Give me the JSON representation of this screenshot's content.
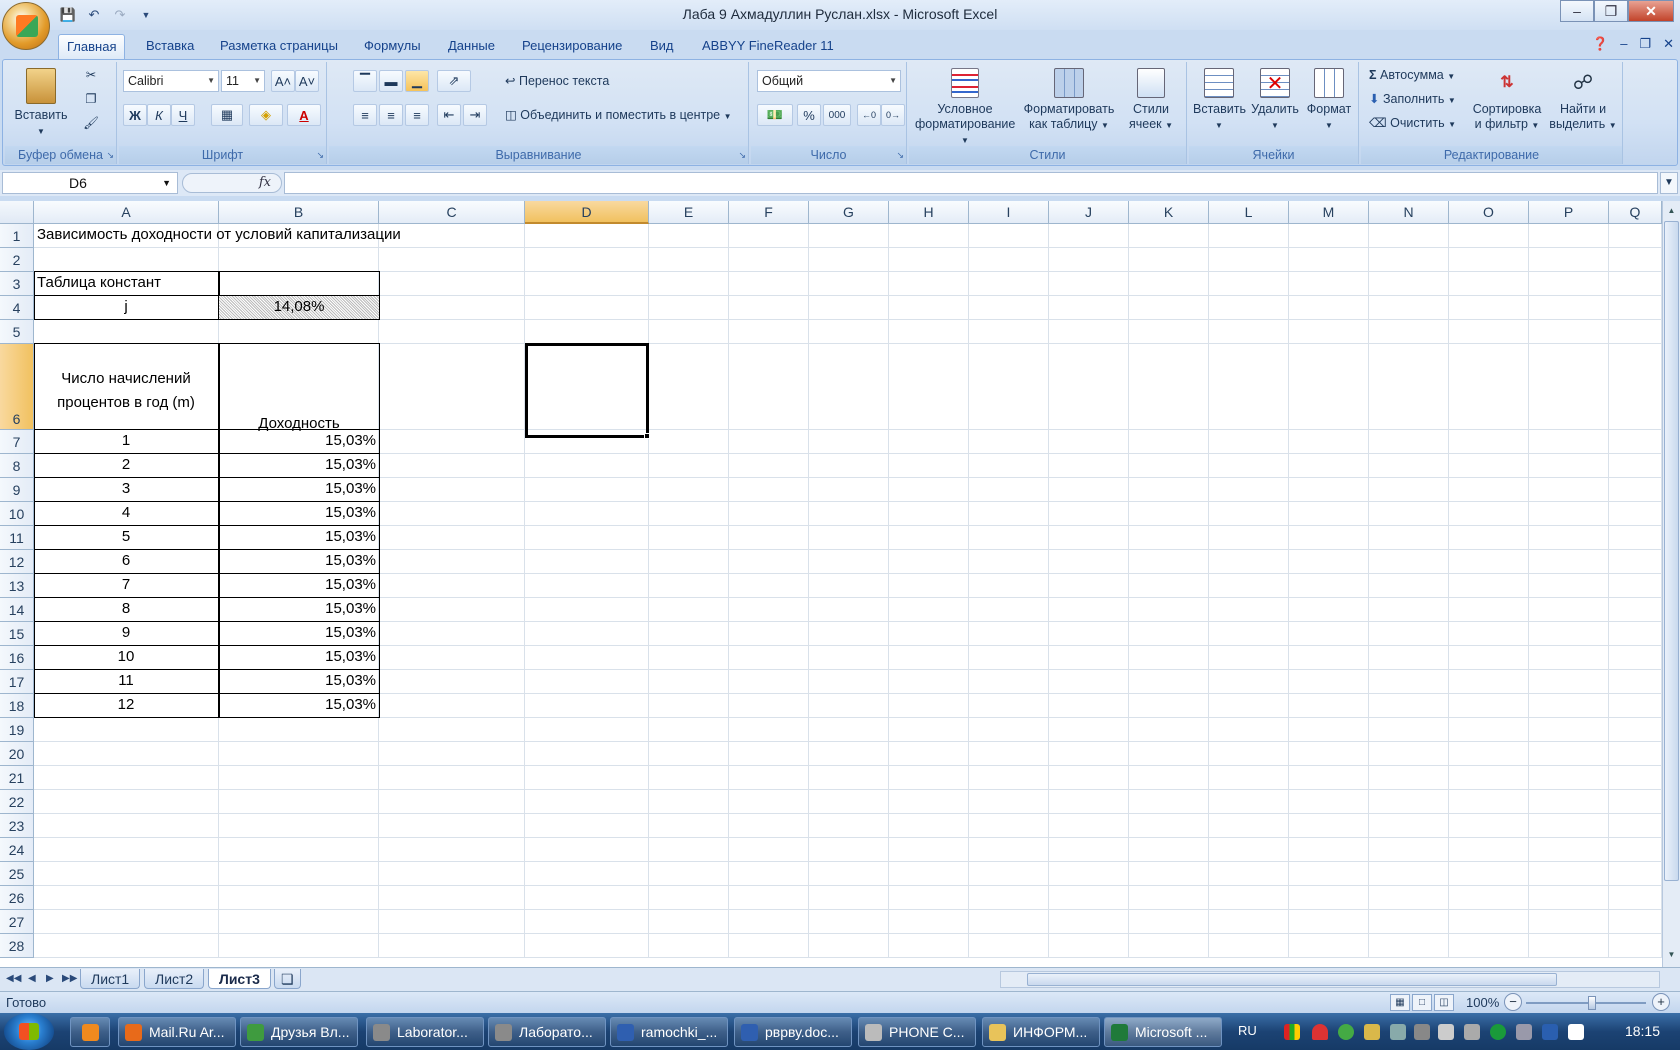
{
  "window": {
    "title": "Лаба 9 Ахмадуллин  Руслан.xlsx - Microsoft Excel",
    "controls": [
      "–",
      "❐",
      "✕"
    ]
  },
  "ribbon_tabs": [
    {
      "label": "Главная",
      "active": true
    },
    {
      "label": "Вставка"
    },
    {
      "label": "Разметка страницы"
    },
    {
      "label": "Формулы"
    },
    {
      "label": "Данные"
    },
    {
      "label": "Рецензирование"
    },
    {
      "label": "Вид"
    },
    {
      "label": "ABBYY FineReader 11"
    }
  ],
  "ribbon": {
    "clipboard": {
      "label": "Буфер обмена",
      "paste": "Вставить"
    },
    "font": {
      "label": "Шрифт",
      "name": "Calibri",
      "size": "11",
      "bold": "Ж",
      "italic": "К",
      "underline": "Ч"
    },
    "alignment": {
      "label": "Выравнивание",
      "wrap": "Перенос текста",
      "merge": "Объединить и поместить в центре"
    },
    "number": {
      "label": "Число",
      "format": "Общий",
      "percent": "%",
      "thousands": "000"
    },
    "styles": {
      "label": "Стили",
      "cond_1": "Условное",
      "cond_2": "форматирование",
      "table_1": "Форматировать",
      "table_2": "как таблицу",
      "cell_1": "Стили",
      "cell_2": "ячеек"
    },
    "cells": {
      "label": "Ячейки",
      "insert": "Вставить",
      "delete": "Удалить",
      "format": "Формат"
    },
    "editing": {
      "label": "Редактирование",
      "autosum": "Автосумма",
      "fill": "Заполнить",
      "clear": "Очистить",
      "sort_1": "Сортировка",
      "sort_2": "и фильтр",
      "find_1": "Найти и",
      "find_2": "выделить"
    }
  },
  "formula_bar": {
    "name_box": "D6",
    "fx": "fx",
    "formula": ""
  },
  "columns": [
    "A",
    "B",
    "C",
    "D",
    "E",
    "F",
    "G",
    "H",
    "I",
    "J",
    "K",
    "L",
    "M",
    "N",
    "O",
    "P",
    "Q"
  ],
  "selected_column": "D",
  "selected_row": 6,
  "rows": [
    "1",
    "2",
    "3",
    "4",
    "5",
    "6",
    "7",
    "8",
    "9",
    "10",
    "11",
    "12",
    "13",
    "14",
    "15",
    "16",
    "17",
    "18",
    "19",
    "20",
    "21",
    "22",
    "23",
    "24",
    "25",
    "26",
    "27",
    "28"
  ],
  "sheet": {
    "title": "Зависимость доходности от условий капитализации",
    "constants_header": "Таблица констант",
    "j_label": "j",
    "j_value": "14,08%",
    "col_m_header": "Число начислений процентов в год (m)",
    "col_yield_header": "Доходность",
    "table": [
      {
        "m": "1",
        "yield": "15,03%"
      },
      {
        "m": "2",
        "yield": "15,03%"
      },
      {
        "m": "3",
        "yield": "15,03%"
      },
      {
        "m": "4",
        "yield": "15,03%"
      },
      {
        "m": "5",
        "yield": "15,03%"
      },
      {
        "m": "6",
        "yield": "15,03%"
      },
      {
        "m": "7",
        "yield": "15,03%"
      },
      {
        "m": "8",
        "yield": "15,03%"
      },
      {
        "m": "9",
        "yield": "15,03%"
      },
      {
        "m": "10",
        "yield": "15,03%"
      },
      {
        "m": "11",
        "yield": "15,03%"
      },
      {
        "m": "12",
        "yield": "15,03%"
      }
    ]
  },
  "sheet_tabs": [
    {
      "label": "Лист1"
    },
    {
      "label": "Лист2"
    },
    {
      "label": "Лист3",
      "active": true
    }
  ],
  "status": {
    "ready": "Готово",
    "zoom": "100%"
  },
  "taskbar": {
    "items": [
      {
        "label": "Mail.Ru Ar...",
        "color": "#e86a1a"
      },
      {
        "label": "Друзья Вл...",
        "color": "#3f9b3f"
      },
      {
        "label": "Laborator...",
        "color": "#8a8a8a"
      },
      {
        "label": "Лаборато...",
        "color": "#8a8a8a"
      },
      {
        "label": "ramochki_...",
        "color": "#2f5fb0"
      },
      {
        "label": "рврву.doc...",
        "color": "#2f5fb0"
      },
      {
        "label": "PHONE C...",
        "color": "#bbbbbb"
      },
      {
        "label": "ИНФОРМ...",
        "color": "#e8c35a"
      },
      {
        "label": "Microsoft ...",
        "color": "#1f7a3a",
        "active": true
      }
    ],
    "lang": "RU",
    "time": "18:15"
  }
}
